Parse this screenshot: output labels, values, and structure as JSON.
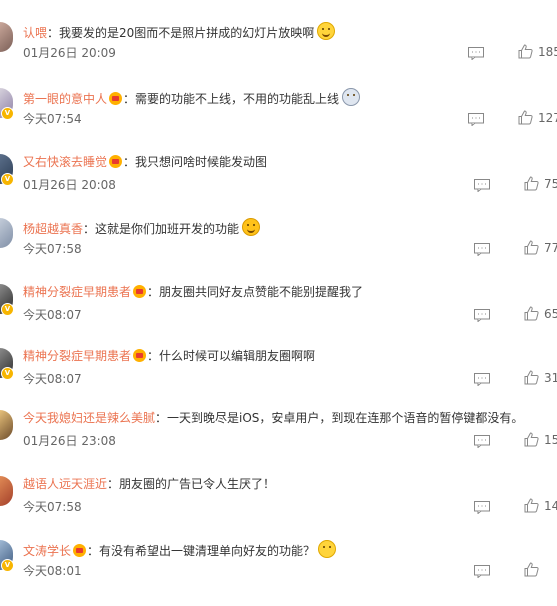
{
  "comments": [
    {
      "username": "认喂",
      "has_badge": false,
      "text": "：我要发的是20图而不是照片拼成的幻灯片放映啊",
      "emoji": "smile-emoji",
      "time": "01月26日 20:09",
      "likes": "185",
      "avatar_colors": [
        "#c9a79a",
        "#7a5e56"
      ]
    },
    {
      "username": "第一眼的意中人",
      "has_badge": true,
      "text": "：需要的功能不上线，不用的功能乱上线",
      "emoji": "crying-emoji",
      "time": "今天07:54",
      "likes": "127",
      "avatar_colors": [
        "#d6d1dc",
        "#8d7fa6"
      ]
    },
    {
      "username": "又右快滚去睡觉",
      "has_badge": true,
      "text": "：我只想问啥时候能发动图",
      "emoji": "",
      "time": "01月26日 20:08",
      "likes": "75",
      "avatar_colors": [
        "#5b6f8a",
        "#2c3d55"
      ]
    },
    {
      "username": "杨超越真香",
      "has_badge": false,
      "text": "：这就是你们加班开发的功能",
      "emoji": "grin-emoji",
      "time": "今天07:58",
      "likes": "77",
      "avatar_colors": [
        "#c3ccd9",
        "#7f8ea6"
      ]
    },
    {
      "username": "精神分裂症早期患者",
      "has_badge": true,
      "text": "：朋友圈共同好友点赞能不能别提醒我了",
      "emoji": "",
      "time": "今天08:07",
      "likes": "65",
      "avatar_colors": [
        "#8a8a8a",
        "#2b2b2b"
      ]
    },
    {
      "username": "精神分裂症早期患者",
      "has_badge": true,
      "text": "：什么时候可以编辑朋友圈啊啊",
      "emoji": "",
      "time": "今天08:07",
      "likes": "31",
      "avatar_colors": [
        "#8a8a8a",
        "#2b2b2b"
      ]
    },
    {
      "username": "今天我媳妇还是辣么美腻",
      "has_badge": false,
      "text": "：一天到晚尽是iOS，安卓用户，到现在连那个语音的暂停键都没有。",
      "emoji": "",
      "time": "01月26日 23:08",
      "likes": "15",
      "avatar_colors": [
        "#e6c07a",
        "#6b4a2a"
      ]
    },
    {
      "username": "越语人远天涯近",
      "has_badge": false,
      "text": "：朋友圈的广告已令人生厌了！",
      "emoji": "",
      "time": "今天07:58",
      "likes": "14",
      "avatar_colors": [
        "#e08a55",
        "#a33f2a"
      ]
    },
    {
      "username": "文涛学长",
      "has_badge": true,
      "text": "：有没有希望出一键清理单向好友的功能？",
      "emoji": "hug-emoji",
      "time": "今天08:01",
      "likes": "",
      "avatar_colors": [
        "#9fb8d4",
        "#3e5b80"
      ]
    }
  ]
}
